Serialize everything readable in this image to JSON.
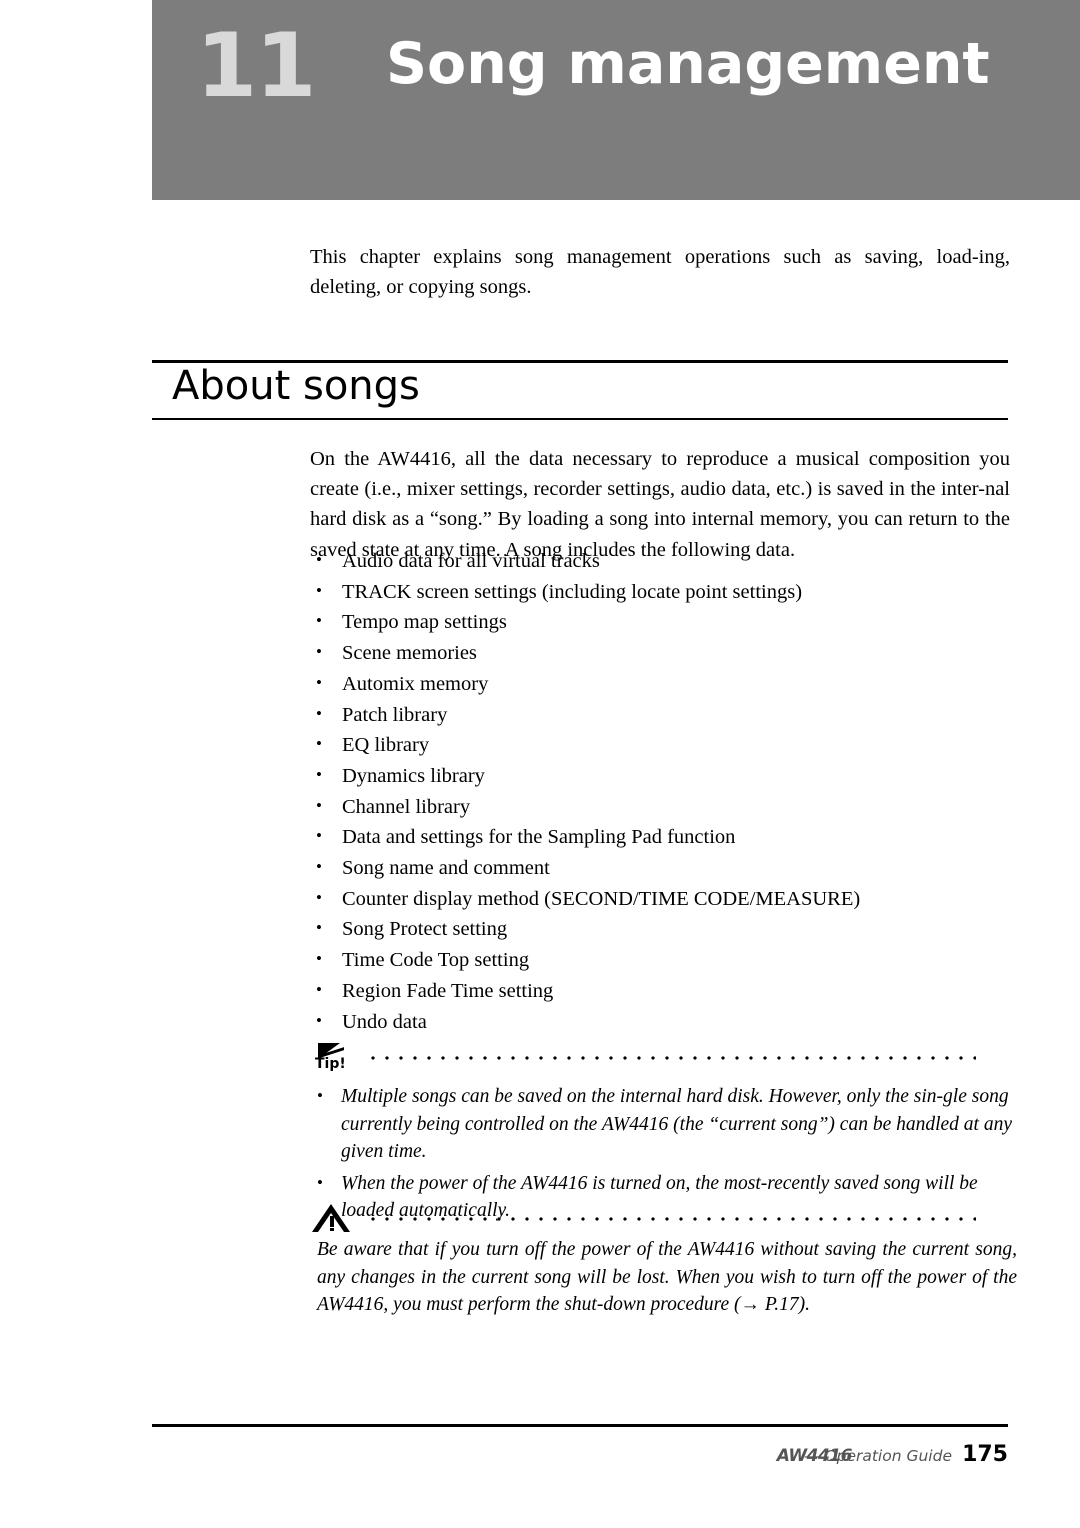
{
  "header": {
    "chapter_number": "11",
    "chapter_title": "Song management"
  },
  "intro": "This chapter explains song management operations such as saving, load-ing, deleting, or copying songs.",
  "section": {
    "title": "About songs",
    "body": "On the AW4416, all the data necessary to reproduce a musical composition you create (i.e., mixer settings, recorder settings, audio data, etc.) is saved in the inter-nal hard disk as a “song.” By loading a song into internal memory, you can return to the saved state at any time. A song includes the following data."
  },
  "bullets": [
    "Audio data for all virtual tracks",
    "TRACK screen settings (including locate point settings)",
    "Tempo map settings",
    "Scene memories",
    "Automix memory",
    "Patch library",
    "EQ library",
    "Dynamics library",
    "Channel library",
    "Data and settings for the Sampling Pad function",
    "Song name and comment",
    "Counter display method (SECOND/TIME CODE/MEASURE)",
    "Song Protect setting",
    "Time Code Top setting",
    "Region Fade Time setting",
    "Undo data"
  ],
  "tip": {
    "label": "Tip!",
    "items": [
      "Multiple songs can be saved on the internal hard disk. However, only the sin-gle song currently being controlled on the AW4416 (the “current song”) can be handled at any given time.",
      "When the power of the AW4416 is turned on, the most-recently saved song will be loaded automatically."
    ]
  },
  "warning": {
    "text": "Be aware that if you turn off the power of the AW4416 without saving the current song, any changes in the current song will be lost. When you wish to turn off the power of the AW4416, you must perform the shut-down procedure (→ P.17)."
  },
  "footer": {
    "logo": "AW4416",
    "guide": "— Operation Guide",
    "page": "175"
  }
}
